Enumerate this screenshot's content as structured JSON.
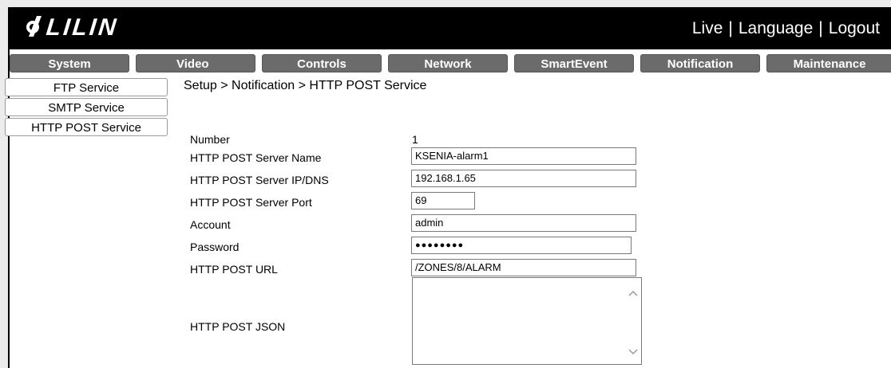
{
  "header": {
    "brand": "LILIN",
    "links": [
      "Live",
      "Language",
      "Logout"
    ],
    "separator": "|"
  },
  "nav": {
    "tabs": [
      "System",
      "Video",
      "Controls",
      "Network",
      "SmartEvent",
      "Notification",
      "Maintenance"
    ]
  },
  "sidebar": {
    "items": [
      "FTP Service",
      "SMTP Service",
      "HTTP POST Service"
    ]
  },
  "breadcrumb": "Setup > Notification > HTTP POST Service",
  "form": {
    "number_label": "Number",
    "number_value": "1",
    "server_name_label": "HTTP POST Server Name",
    "server_name_value": "KSENIA-alarm1",
    "server_ip_label": "HTTP POST Server IP/DNS",
    "server_ip_value": "192.168.1.65",
    "server_port_label": "HTTP POST Server Port",
    "server_port_value": "69",
    "account_label": "Account",
    "account_value": "admin",
    "password_label": "Password",
    "password_value": "●●●●●●●●",
    "url_label": "HTTP POST URL",
    "url_value": "/ZONES/8/ALARM",
    "json_label": "HTTP POST JSON",
    "json_value": ""
  },
  "icons": {
    "scroll_up": "chevron-up-icon",
    "scroll_down": "chevron-down-icon"
  }
}
